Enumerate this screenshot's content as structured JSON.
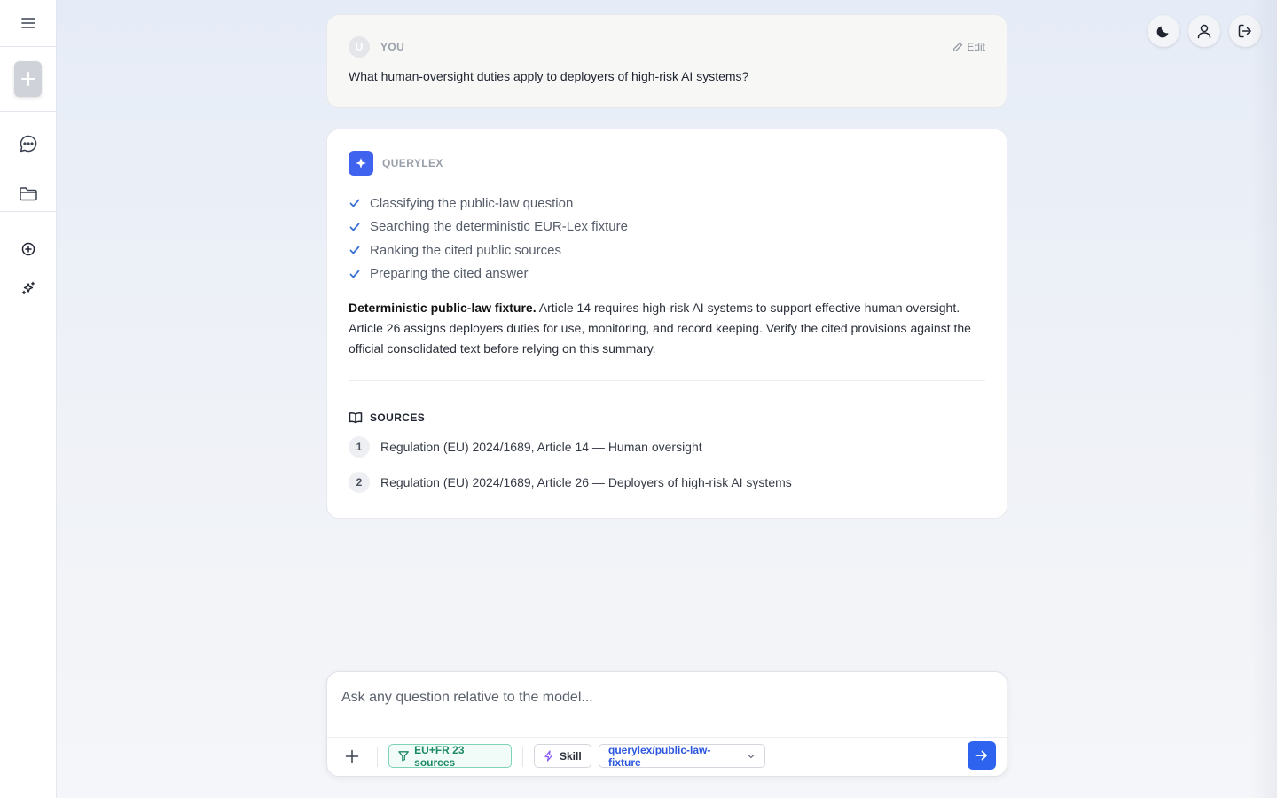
{
  "sidebar": {
    "icons": [
      "menu-icon",
      "plus-icon",
      "chat-icon",
      "folder-icon",
      "add-circle-icon",
      "sparkles-icon"
    ]
  },
  "topbar": {
    "icons": [
      "moon-icon",
      "user-icon",
      "logout-icon"
    ]
  },
  "user_message": {
    "avatar_initial": "U",
    "role": "YOU",
    "edit_label": "Edit",
    "text": "What human-oversight duties apply to deployers of high-risk AI systems?"
  },
  "assistant_message": {
    "role": "QUERYLEX",
    "steps": [
      "Classifying the public-law question",
      "Searching the deterministic EUR-Lex fixture",
      "Ranking the cited public sources",
      "Preparing the cited answer"
    ],
    "answer_lead": "Deterministic public-law fixture.",
    "answer_body": " Article 14 requires high-risk AI systems to support effective human oversight. Article 26 assigns deployers duties for use, monitoring, and record keeping. Verify the cited provisions against the official consolidated text before relying on this summary.",
    "sources_title": "SOURCES",
    "sources": [
      {
        "num": "1",
        "title": "Regulation (EU) 2024/1689, Article 14 — Human oversight"
      },
      {
        "num": "2",
        "title": "Regulation (EU) 2024/1689, Article 26 — Deployers of high-risk AI systems"
      }
    ]
  },
  "composer": {
    "placeholder": "Ask any question relative to the model...",
    "value": "",
    "sources_chip": "EU+FR 23 sources",
    "skill_chip": "Skill",
    "model_chip": "querylex/public-law-fixture"
  },
  "colors": {
    "accent": "#2d63ef",
    "logo": "#3f63ee",
    "sources_chip": "#1d8a66",
    "check": "#3b6fd8"
  }
}
